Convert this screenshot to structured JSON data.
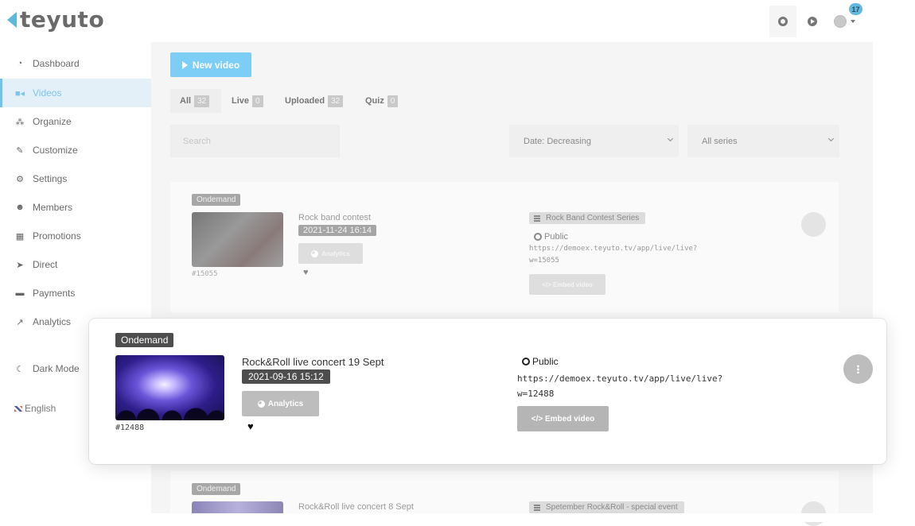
{
  "brand": {
    "name": "teyuto",
    "accent": "#5db8d9"
  },
  "header": {
    "support_icon": "lifebuoy-icon",
    "play_icon": "play-circle-icon",
    "notification_count": "17"
  },
  "sidebar": {
    "items": [
      {
        "label": "Dashboard",
        "icon": "dashboard-icon",
        "active": false
      },
      {
        "label": "Videos",
        "icon": "video-camera-icon",
        "active": true
      },
      {
        "label": "Organize",
        "icon": "sitemap-icon",
        "active": false
      },
      {
        "label": "Customize",
        "icon": "brush-icon",
        "active": false
      },
      {
        "label": "Settings",
        "icon": "gears-icon",
        "active": false
      },
      {
        "label": "Members",
        "icon": "users-icon",
        "active": false
      },
      {
        "label": "Promotions",
        "icon": "gift-icon",
        "active": false
      },
      {
        "label": "Direct",
        "icon": "paper-plane-icon",
        "active": false
      },
      {
        "label": "Payments",
        "icon": "wallet-icon",
        "active": false
      },
      {
        "label": "Analytics",
        "icon": "chart-line-icon",
        "active": false
      }
    ],
    "dark_mode_label": "Dark Mode",
    "language": "English"
  },
  "toolbar": {
    "new_video_label": "New video",
    "tabs": [
      {
        "label": "All",
        "count": "32",
        "active": true
      },
      {
        "label": "Live",
        "count": "0",
        "active": false
      },
      {
        "label": "Uploaded",
        "count": "32",
        "active": false
      },
      {
        "label": "Quiz",
        "count": "0",
        "active": false
      }
    ],
    "search_placeholder": "Search",
    "sort_selected": "Date: Decreasing",
    "series_selected": "All series"
  },
  "videos": [
    {
      "type": "Ondemand",
      "title": "Rock band contest",
      "date": "2021-11-24 16:14",
      "id": "#15055",
      "analytics_label": "Analytics",
      "series": "Rock Band Contest Series",
      "visibility": "Public",
      "url_line1": "https://demoex.teyuto.tv/app/live/live?",
      "url_line2": "w=15055",
      "embed_label": "Embed video"
    },
    {
      "type": "Ondemand",
      "title": "Rock&Roll live concert 19 Sept",
      "date": "2021-09-16 15:12",
      "id": "#12488",
      "analytics_label": "Analytics",
      "visibility": "Public",
      "url_line1": "https://demoex.teyuto.tv/app/live/live?",
      "url_line2": "w=12488",
      "embed_label": "Embed video"
    },
    {
      "type": "Ondemand",
      "title": "Rock&Roll live concert 8 Sept",
      "series": "Spetember Rock&Roll - special event"
    }
  ]
}
